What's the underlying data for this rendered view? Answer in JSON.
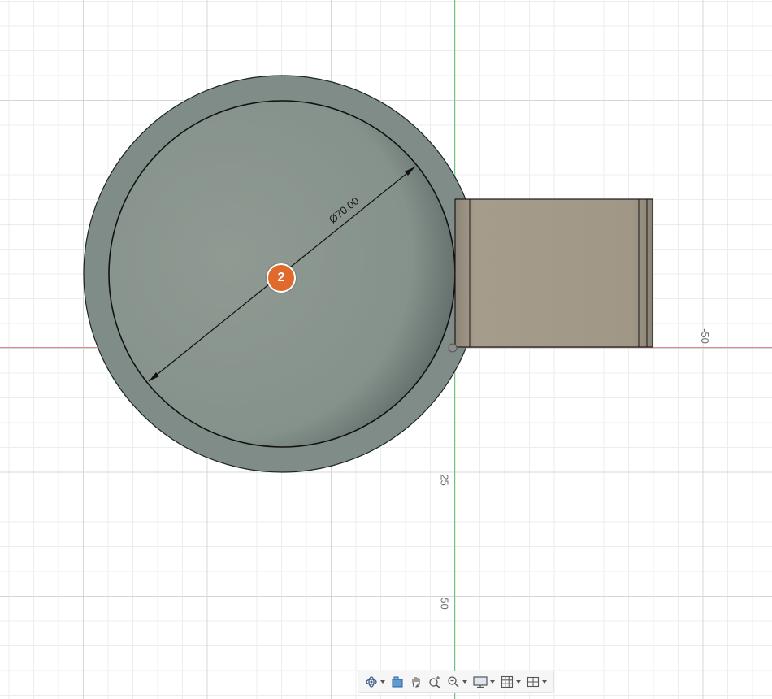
{
  "viewport": {
    "axis_labels": {
      "x_neg50": "-50",
      "y_25": "25",
      "y_50": "50"
    },
    "dimension": {
      "diameter_text": "Ø70.00"
    },
    "marker": {
      "number": "2"
    },
    "colors": {
      "disk_outer": "#7e8a86",
      "disk_inner": "#8a9891",
      "handle": "#a49a8a",
      "x_axis": "#e48a8a",
      "y_axis": "#6cc86c",
      "marker": "#e06a2c"
    }
  },
  "navigation_bar": {
    "items": [
      {
        "icon": "orbit-icon",
        "has_dropdown": true
      },
      {
        "icon": "look-at-icon",
        "has_dropdown": false
      },
      {
        "icon": "pan-icon",
        "has_dropdown": false
      },
      {
        "icon": "zoom-icon",
        "has_dropdown": false
      },
      {
        "icon": "fit-icon",
        "has_dropdown": true
      },
      {
        "icon": "display-settings-icon",
        "has_dropdown": true
      },
      {
        "icon": "grid-settings-icon",
        "has_dropdown": true
      },
      {
        "icon": "viewports-icon",
        "has_dropdown": true
      }
    ]
  }
}
